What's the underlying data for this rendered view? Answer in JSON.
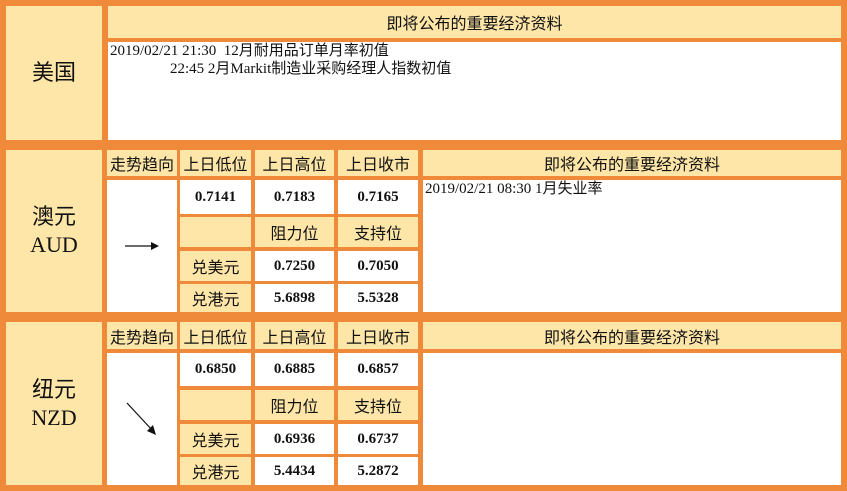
{
  "us": {
    "country": "美国",
    "header": "即将公布的重要经济资料",
    "news": [
      "2019/02/21 21:30  12月耐用品订单月率初值",
      "                22:45 2月Markit制造业采购经理人指数初值"
    ]
  },
  "aud": {
    "country_cn": "澳元",
    "country_code": "AUD",
    "trend_label": "走势趋向",
    "col_prev_low": "上日低位",
    "col_prev_high": "上日高位",
    "col_prev_close": "上日收市",
    "prev_low": "0.7141",
    "prev_high": "0.7183",
    "prev_close": "0.7165",
    "resistance_label": "阻力位",
    "support_label": "支持位",
    "usd_label": "兑美元",
    "usd_resistance": "0.7250",
    "usd_support": "0.7050",
    "hkd_label": "兑港元",
    "hkd_resistance": "5.6898",
    "hkd_support": "5.5328",
    "trend_icon": "right-arrow-icon",
    "news_header": "即将公布的重要经济资料",
    "news": "2019/02/21 08:30 1月失业率"
  },
  "nzd": {
    "country_cn": "纽元",
    "country_code": "NZD",
    "trend_label": "走势趋向",
    "col_prev_low": "上日低位",
    "col_prev_high": "上日高位",
    "col_prev_close": "上日收市",
    "prev_low": "0.6850",
    "prev_high": "0.6885",
    "prev_close": "0.6857",
    "resistance_label": "阻力位",
    "support_label": "支持位",
    "usd_label": "兑美元",
    "usd_resistance": "0.6936",
    "usd_support": "0.6737",
    "hkd_label": "兑港元",
    "hkd_resistance": "5.4434",
    "hkd_support": "5.2872",
    "trend_icon": "down-right-arrow-icon",
    "news_header": "即将公布的重要经济资料",
    "news": ""
  },
  "colors": {
    "border_orange": "#ef8a3a",
    "header_cream": "#fde6a8"
  }
}
